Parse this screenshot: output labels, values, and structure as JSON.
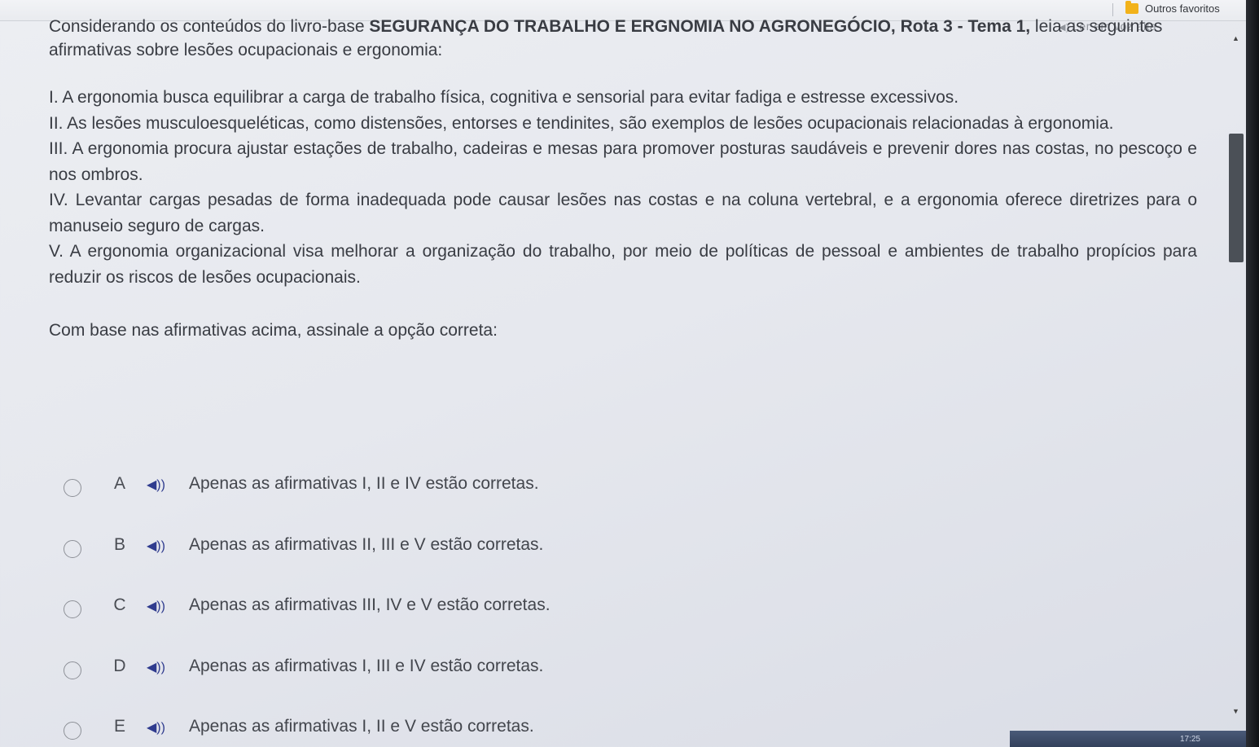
{
  "browser": {
    "bookmark_folder_label": "Outros favoritos"
  },
  "tts": {
    "label": "Ler em voz alta"
  },
  "question": {
    "intro_part1": "Considerando os conteúdos do livro-base ",
    "intro_bold": "SEGURANÇA DO TRABALHO E ERGNOMIA NO AGRONEGÓCIO, Rota 3 - Tema 1,",
    "intro_part2": " leia as seguintes afirmativas sobre lesões ocupacionais e ergonomia:",
    "statements": [
      "I. A ergonomia busca equilibrar a carga de trabalho física, cognitiva e sensorial para evitar fadiga e estresse excessivos.",
      "II. As lesões musculoesqueléticas, como distensões, entorses e tendinites, são exemplos de lesões ocupacionais relacionadas à ergonomia.",
      "III. A ergonomia procura ajustar estações de trabalho, cadeiras e mesas para promover posturas saudáveis e prevenir dores nas costas, no pescoço e nos ombros.",
      "IV. Levantar cargas pesadas de forma inadequada pode causar lesões nas costas e na coluna vertebral, e a ergonomia oferece diretrizes para o manuseio seguro de cargas.",
      "V. A ergonomia organizacional visa melhorar a organização do trabalho, por meio de políticas de pessoal e ambientes de trabalho propícios para reduzir os riscos de lesões ocupacionais."
    ],
    "prompt": "Com base nas afirmativas acima, assinale a opção correta:"
  },
  "options": [
    {
      "letter": "A",
      "text": "Apenas as afirmativas I, II e IV estão corretas."
    },
    {
      "letter": "B",
      "text": "Apenas as afirmativas II, III e V estão corretas."
    },
    {
      "letter": "C",
      "text": "Apenas as afirmativas III, IV e V estão corretas."
    },
    {
      "letter": "D",
      "text": "Apenas as afirmativas I, III e IV estão corretas."
    },
    {
      "letter": "E",
      "text": "Apenas as afirmativas I, II e V estão corretas."
    }
  ],
  "taskbar": {
    "clock": "17:25"
  }
}
